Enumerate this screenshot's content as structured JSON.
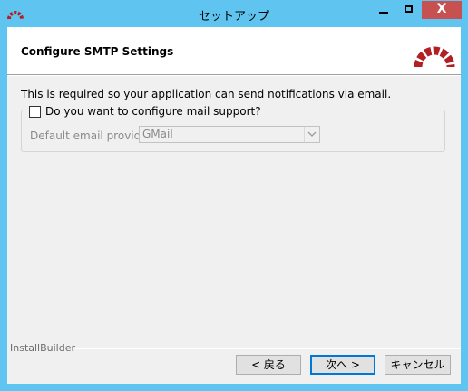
{
  "window": {
    "title": "セットアップ",
    "app_icon": "redmine-icon",
    "controls": {
      "minimize_icon": "minimize-icon",
      "maximize_icon": "maximize-icon",
      "close_icon": "close-icon",
      "close_glyph": "X"
    }
  },
  "header": {
    "title": "Configure SMTP Settings",
    "logo_icon": "redmine-logo-icon"
  },
  "main": {
    "description": "This is required so your application can send notifications via email.",
    "mail_support": {
      "label": "Do you want to configure mail support?",
      "checked": false
    },
    "provider": {
      "label": "Default email provider:",
      "selected": "GMail",
      "disabled": true
    }
  },
  "footer": {
    "brand": "InstallBuilder",
    "back_label": "< 戻る",
    "next_label": "次へ >",
    "cancel_label": "キャンセル"
  },
  "colors": {
    "titlebar": "#5fc4ef",
    "close_button": "#c75050",
    "logo_red": "#b32024",
    "default_button_border": "#0078d7"
  }
}
